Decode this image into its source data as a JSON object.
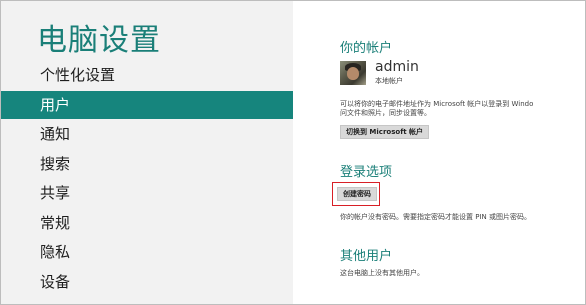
{
  "app": {
    "title": "电脑设置"
  },
  "nav": {
    "items": [
      {
        "label": "个性化设置",
        "selected": false
      },
      {
        "label": "用户",
        "selected": true
      },
      {
        "label": "通知",
        "selected": false
      },
      {
        "label": "搜索",
        "selected": false
      },
      {
        "label": "共享",
        "selected": false
      },
      {
        "label": "常规",
        "selected": false
      },
      {
        "label": "隐私",
        "selected": false
      },
      {
        "label": "设备",
        "selected": false
      }
    ]
  },
  "account": {
    "title": "你的帐户",
    "username": "admin",
    "type": "本地帐户",
    "description_line1": "可以将你的电子邮件地址作为 Microsoft 帐户以登录到 Windo",
    "description_line2": "问文件和照片，同步设置等。",
    "switch_button": "切换到 Microsoft 帐户"
  },
  "signin": {
    "title": "登录选项",
    "create_password_button": "创建密码",
    "note": "你的帐户没有密码。需要指定密码才能设置 PIN 或图片密码。"
  },
  "other_users": {
    "title": "其他用户",
    "note": "这台电脑上没有其他用户。"
  },
  "colors": {
    "accent": "#16857d",
    "highlight": "#d81f26"
  }
}
